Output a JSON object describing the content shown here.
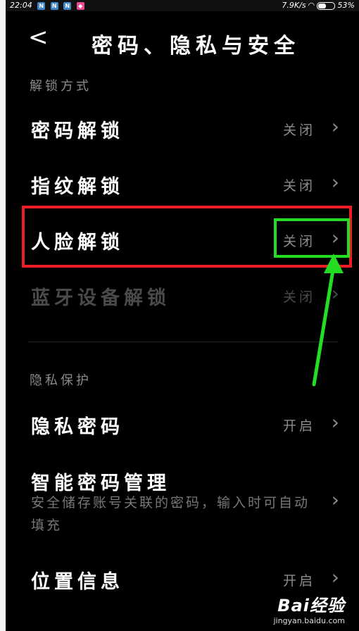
{
  "status_bar": {
    "time": "22:04",
    "network_speed": "7.9K/s",
    "battery_percent": "53%",
    "battery_level": 0.53
  },
  "header": {
    "title": "密码、隐私与安全"
  },
  "sections": {
    "unlock": {
      "title": "解锁方式",
      "items": [
        {
          "label": "密码解锁",
          "value": "关闭"
        },
        {
          "label": "指纹解锁",
          "value": "关闭"
        },
        {
          "label": "人脸解锁",
          "value": "关闭"
        },
        {
          "label": "蓝牙设备解锁",
          "value": "关闭"
        }
      ]
    },
    "privacy": {
      "title": "隐私保护",
      "items": [
        {
          "label": "隐私密码",
          "value": "开启"
        },
        {
          "label": "智能密码管理",
          "subtitle": "安全储存账号关联的密码，输入时可自动填充"
        },
        {
          "label": "位置信息",
          "value": "开启"
        }
      ]
    }
  },
  "annotation_colors": {
    "red_box": "#ee1c24",
    "green_box": "#22dd22",
    "arrow": "#22dd22"
  },
  "watermark": {
    "brand": "Bai经验",
    "site": "jingyan.baidu.com"
  }
}
